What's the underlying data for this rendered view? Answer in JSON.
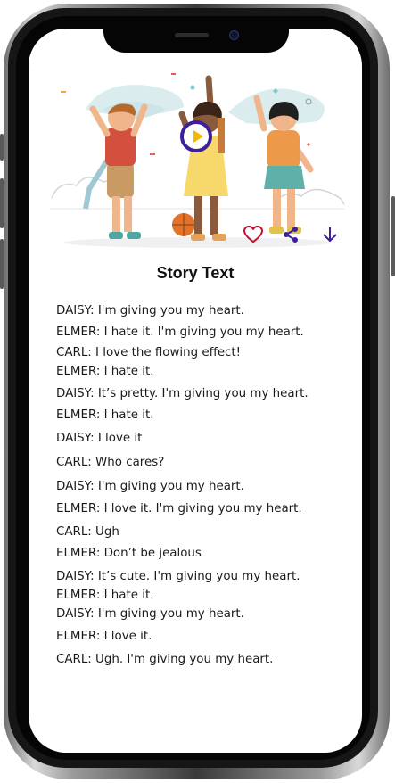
{
  "story": {
    "title": "Story Text",
    "lines": [
      "DAISY: I'm giving you my heart.",
      "ELMER: I hate it. I'm giving you my heart.",
      "CARL: I love the flowing effect!",
      "ELMER: I hate it.",
      "DAISY: It’s pretty. I'm giving you my heart.",
      "ELMER: I hate it.",
      "DAISY: I love it",
      "CARL: Who cares?",
      "DAISY: I'm giving you my heart.",
      "ELMER: I love it. I'm giving you my heart.",
      "CARL: Ugh",
      "ELMER: Don’t be jealous",
      "DAISY: It’s cute. I'm giving you my heart.",
      "ELMER: I hate it.",
      "DAISY: I'm giving you my heart.",
      "ELMER: I love it.",
      "CARL: Ugh. I'm giving you my heart."
    ]
  },
  "actions": {
    "like_icon": "heart-icon",
    "share_icon": "share-icon",
    "download_icon": "arrow-down-icon"
  },
  "colors": {
    "accent": "#3d1f9c",
    "heart": "#c8102e",
    "play_fill": "#f5b800"
  }
}
